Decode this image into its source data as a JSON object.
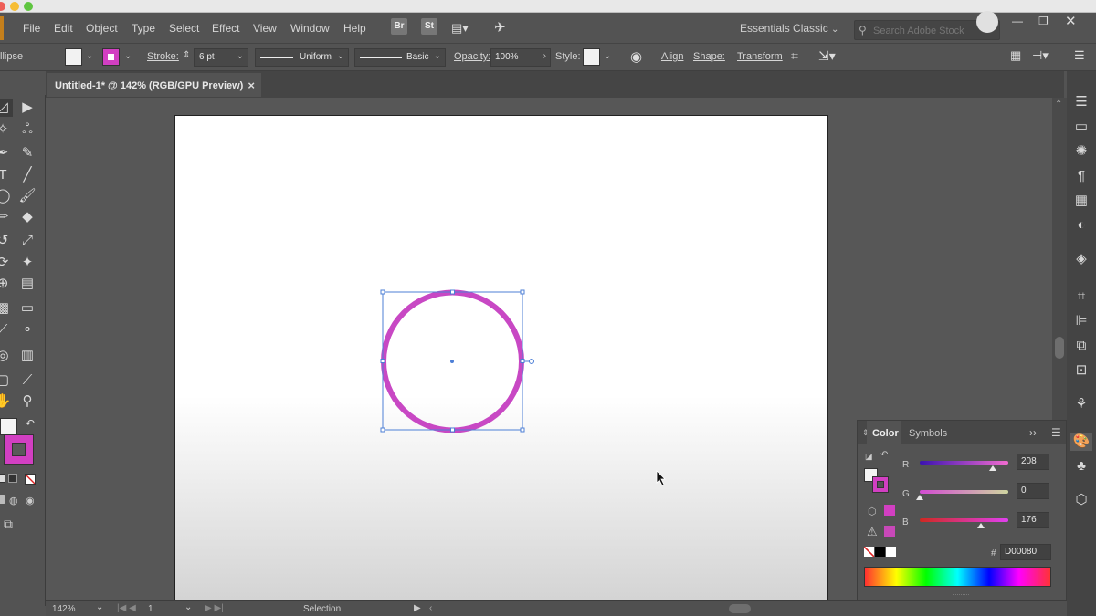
{
  "menubar": {
    "items": [
      "File",
      "Edit",
      "Object",
      "Type",
      "Select",
      "Effect",
      "View",
      "Window",
      "Help"
    ],
    "bridge_label": "Br",
    "stock_label": "St",
    "workspace": "Essentials Classic",
    "search_placeholder": "Search Adobe Stock"
  },
  "control_bar": {
    "object_type": "llipse",
    "stroke_label": "Stroke:",
    "stroke_weight": "6 pt",
    "profile": "Uniform",
    "brush": "Basic",
    "opacity_label": "Opacity:",
    "opacity_value": "100%",
    "style_label": "Style:",
    "align_label": "Align",
    "shape_label": "Shape:",
    "transform_label": "Transform"
  },
  "document": {
    "tab_title": "Untitled-1* @ 142% (RGB/GPU Preview)",
    "close_glyph": "×"
  },
  "colors": {
    "stroke": "#D000B0",
    "stroke_rendered": "#C848C4",
    "selection": "#4d7fd6"
  },
  "color_panel": {
    "tabs": [
      "Color",
      "Symbols"
    ],
    "r_label": "R",
    "r_value": "208",
    "g_label": "G",
    "g_value": "0",
    "b_label": "B",
    "b_value": "176",
    "hex_label": "#",
    "hex_value": "D00080",
    "r_level": 0.82,
    "g_level": 0.0,
    "b_level": 0.69
  },
  "status_bar": {
    "zoom": "142%",
    "artboard_number": "1",
    "tool_name": "Selection"
  }
}
